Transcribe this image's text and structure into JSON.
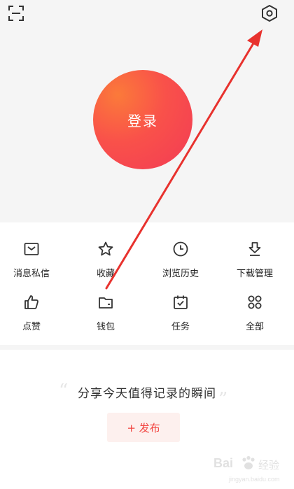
{
  "header": {
    "scan_icon": "scan-icon",
    "settings_icon": "settings-hexagon-icon"
  },
  "login": {
    "label": "登录"
  },
  "menu": {
    "items": [
      {
        "label": "消息私信",
        "icon": "message-envelope-icon"
      },
      {
        "label": "收藏",
        "icon": "star-icon"
      },
      {
        "label": "浏览历史",
        "icon": "clock-icon"
      },
      {
        "label": "下载管理",
        "icon": "download-icon"
      },
      {
        "label": "点赞",
        "icon": "thumbs-up-icon"
      },
      {
        "label": "钱包",
        "icon": "wallet-icon"
      },
      {
        "label": "任务",
        "icon": "calendar-check-icon"
      },
      {
        "label": "全部",
        "icon": "grid-circles-icon"
      }
    ]
  },
  "share": {
    "quote_open": "“",
    "text": "分享今天值得记录的瞬间",
    "quote_close": "”",
    "publish_label": "+ 发布"
  },
  "watermark": {
    "brand": "Bai",
    "text": "经验",
    "url": "jingyan.baidu.com"
  },
  "colors": {
    "accent": "#f2433f",
    "login_gradient_start": "#fb7a3a",
    "login_gradient_end": "#f23b55",
    "annotation_arrow": "#e8322e"
  }
}
